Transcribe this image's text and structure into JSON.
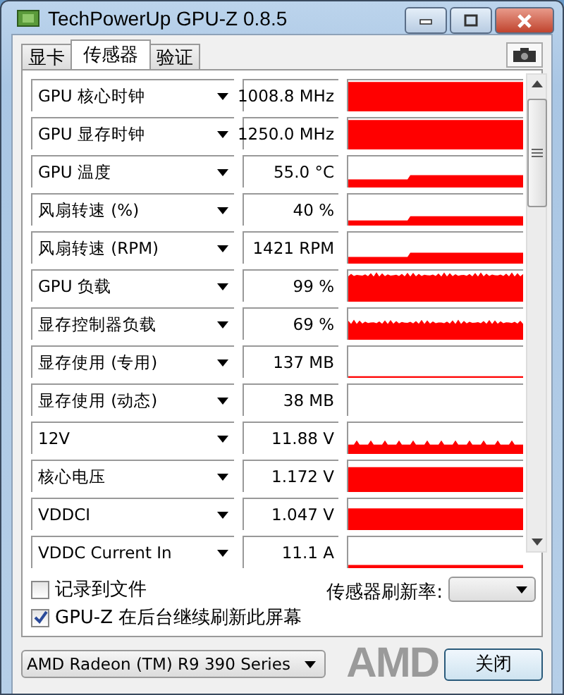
{
  "window": {
    "title": "TechPowerUp GPU-Z 0.8.5"
  },
  "tabs": [
    {
      "label": "显卡",
      "selected": false
    },
    {
      "label": "传感器",
      "selected": true
    },
    {
      "label": "验证",
      "selected": false
    }
  ],
  "sensors": [
    {
      "name": "GPU 核心时钟",
      "value": "1008.8 MHz"
    },
    {
      "name": "GPU 显存时钟",
      "value": "1250.0 MHz"
    },
    {
      "name": "GPU 温度",
      "value": "55.0 °C"
    },
    {
      "name": "风扇转速 (%)",
      "value": "40 %"
    },
    {
      "name": "风扇转速 (RPM)",
      "value": "1421 RPM"
    },
    {
      "name": "GPU 负载",
      "value": "99 %"
    },
    {
      "name": "显存控制器负载",
      "value": "69 %"
    },
    {
      "name": "显存使用 (专用)",
      "value": "137 MB"
    },
    {
      "name": "显存使用 (动态)",
      "value": "38 MB"
    },
    {
      "name": "12V",
      "value": "11.88 V"
    },
    {
      "name": "核心电压",
      "value": "1.172 V"
    },
    {
      "name": "VDDCI",
      "value": "1.047 V"
    },
    {
      "name": "VDDC Current In",
      "value": "11.1 A"
    }
  ],
  "log_to_file": {
    "label": "记录到文件",
    "checked": false
  },
  "background_refresh": {
    "label": "GPU-Z 在后台继续刷新此屏幕",
    "checked": true
  },
  "refresh_rate": {
    "label": "传感器刷新率:"
  },
  "device": {
    "value": "AMD Radeon (TM) R9 390 Series"
  },
  "logo": "AMD",
  "close_button": "关闭"
}
